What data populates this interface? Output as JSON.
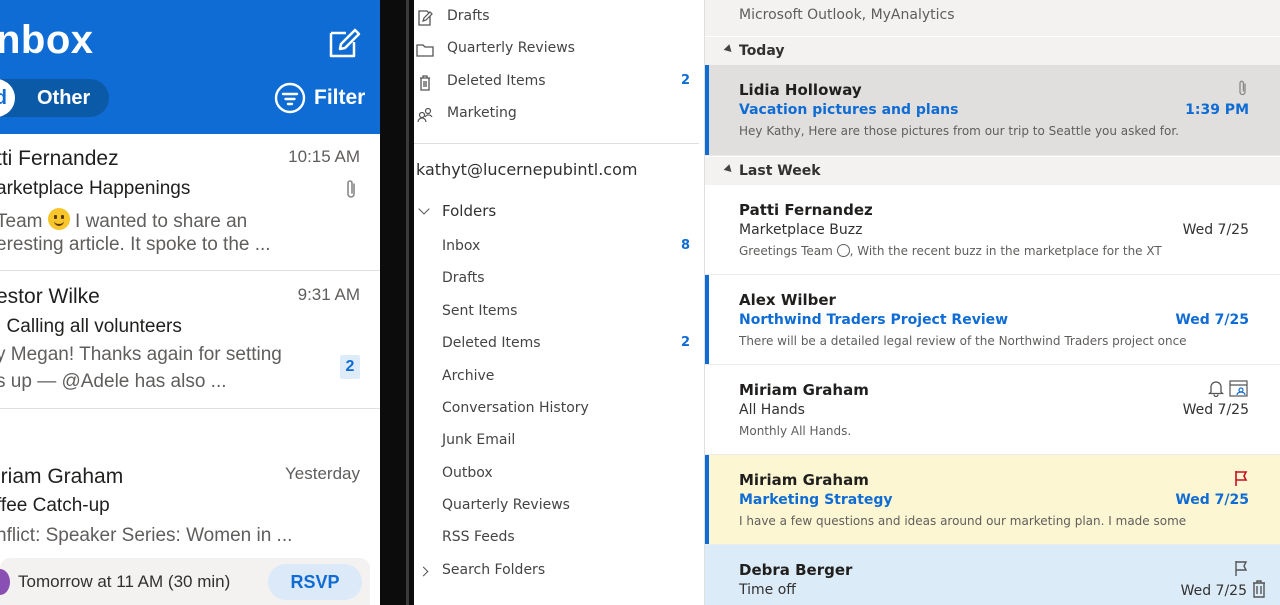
{
  "mobile": {
    "title": "nbox",
    "tabs": {
      "focused": "d",
      "other": "Other"
    },
    "filter_label": "Filter",
    "messages": [
      {
        "sender": "tti Fernandez",
        "time": "10:15 AM",
        "subject": "arketplace Happenings",
        "preview_line1_pre": "Team",
        "preview_line1_post": "I wanted to share an",
        "preview_line2": "eresting article. It spoke to the ...",
        "attachment": true
      },
      {
        "sender": "estor Wilke",
        "time": "9:31 AM",
        "subject": ": Calling all volunteers",
        "preview_line1": "y Megan! Thanks again for setting",
        "preview_line2": "s up — @Adele has also ...",
        "badge": "2"
      },
      {
        "sender": "iriam Graham",
        "time": "Yesterday",
        "subject": "ffee Catch-up",
        "preview_line1": "nflict: Speaker Series: Women in ..."
      }
    ],
    "event": {
      "text": "Tomorrow at 11 AM (30 min)",
      "rsvp": "RSVP"
    }
  },
  "folder_pane": {
    "favorites": [
      {
        "label": "Drafts",
        "icon": "draft-icon"
      },
      {
        "label": "Quarterly Reviews",
        "icon": "folder-icon"
      },
      {
        "label": "Deleted Items",
        "icon": "trash-icon",
        "count": "2"
      },
      {
        "label": "Marketing",
        "icon": "group-icon"
      }
    ],
    "account": "kathyt@lucernepubintl.com",
    "folders_header": "Folders",
    "folders": [
      {
        "label": "Inbox",
        "count": "8"
      },
      {
        "label": "Drafts"
      },
      {
        "label": "Sent Items"
      },
      {
        "label": "Deleted Items",
        "count": "2"
      },
      {
        "label": "Archive"
      },
      {
        "label": "Conversation History"
      },
      {
        "label": "Junk Email"
      },
      {
        "label": "Outbox"
      },
      {
        "label": "Quarterly Reviews"
      },
      {
        "label": "RSS Feeds"
      }
    ],
    "search_folders": "Search Folders"
  },
  "message_list": {
    "top_fragment": "Microsoft Outlook, MyAnalytics",
    "groups": {
      "today": "Today",
      "last_week": "Last Week"
    },
    "today": [
      {
        "sender": "Lidia Holloway",
        "subject": "Vacation pictures and plans",
        "preview": "Hey Kathy,  Here are those pictures from our trip to Seattle you asked for.",
        "date": "1:39 PM",
        "unread": true,
        "selected": true,
        "attachment": true
      }
    ],
    "last_week": [
      {
        "sender": "Patti Fernandez",
        "subject": "Marketplace Buzz",
        "preview_pre": "Greetings Team",
        "preview_post": ",  With the recent buzz in the marketplace for the XT",
        "date": "Wed 7/25"
      },
      {
        "sender": "Alex Wilber",
        "subject": "Northwind Traders Project Review",
        "preview": "There will be a detailed legal review of the Northwind Traders project once",
        "date": "Wed 7/25",
        "unread": true
      },
      {
        "sender": "Miriam Graham",
        "subject": "All Hands",
        "preview": "Monthly All Hands.",
        "date": "Wed 7/25",
        "reminder": true
      },
      {
        "sender": "Miriam Graham",
        "subject": "Marketing Strategy",
        "preview": "I have a few questions and ideas around our marketing plan.  I made some",
        "date": "Wed 7/25",
        "unread": true,
        "flagged": true
      },
      {
        "sender": "Debra Berger",
        "subject": "Time off",
        "date": "Wed 7/25",
        "hover": true
      }
    ]
  },
  "colors": {
    "accent": "#0f6cd4",
    "selected_row": "#e1dfdd",
    "flagged_row": "#fdf6d3",
    "hover_row": "#dcebf8",
    "flag": "#c50f1f"
  }
}
